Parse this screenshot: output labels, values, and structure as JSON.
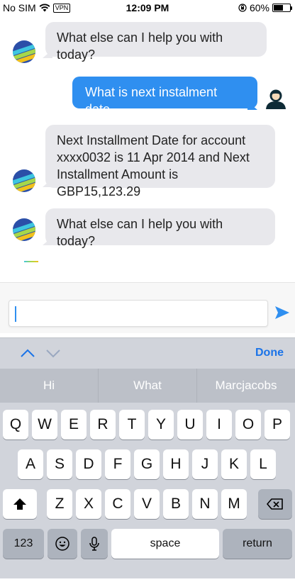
{
  "status_bar": {
    "carrier": "No SIM",
    "vpn": "VPN",
    "time": "12:09 PM",
    "battery_percent": "60%",
    "battery_level": 0.6
  },
  "messages": [
    {
      "sender": "bot",
      "text": "What else can I help you with today?"
    },
    {
      "sender": "user",
      "text": "What is next instalment date"
    },
    {
      "sender": "bot",
      "lines": [
        "Next Installment Date for account",
        "xxxx0032 is 11 Apr 2014 and Next",
        "Installment Amount is GBP15,123.29"
      ]
    },
    {
      "sender": "bot",
      "text": "What else can I help you with today?"
    }
  ],
  "input": {
    "value": "",
    "placeholder": ""
  },
  "accessory": {
    "done_label": "Done"
  },
  "keyboard": {
    "suggestions": [
      "Hi",
      "What",
      "Marcjacobs"
    ],
    "row1": [
      "Q",
      "W",
      "E",
      "R",
      "T",
      "Y",
      "U",
      "I",
      "O",
      "P"
    ],
    "row2": [
      "A",
      "S",
      "D",
      "F",
      "G",
      "H",
      "J",
      "K",
      "L"
    ],
    "row3": [
      "Z",
      "X",
      "C",
      "V",
      "B",
      "N",
      "M"
    ],
    "numbers_key": "123",
    "space_key": "space",
    "return_key": "return"
  },
  "colors": {
    "accent": "#2f8ff0",
    "bot_bubble": "#e8e8ec",
    "keyboard_bg": "#d1d4db"
  },
  "icons": [
    "wifi-icon",
    "rotation-lock-icon",
    "battery-icon",
    "bot-avatar-icon",
    "user-avatar-icon",
    "send-icon",
    "chevron-up-icon",
    "chevron-down-icon",
    "shift-icon",
    "backspace-icon",
    "emoji-icon",
    "microphone-icon"
  ]
}
